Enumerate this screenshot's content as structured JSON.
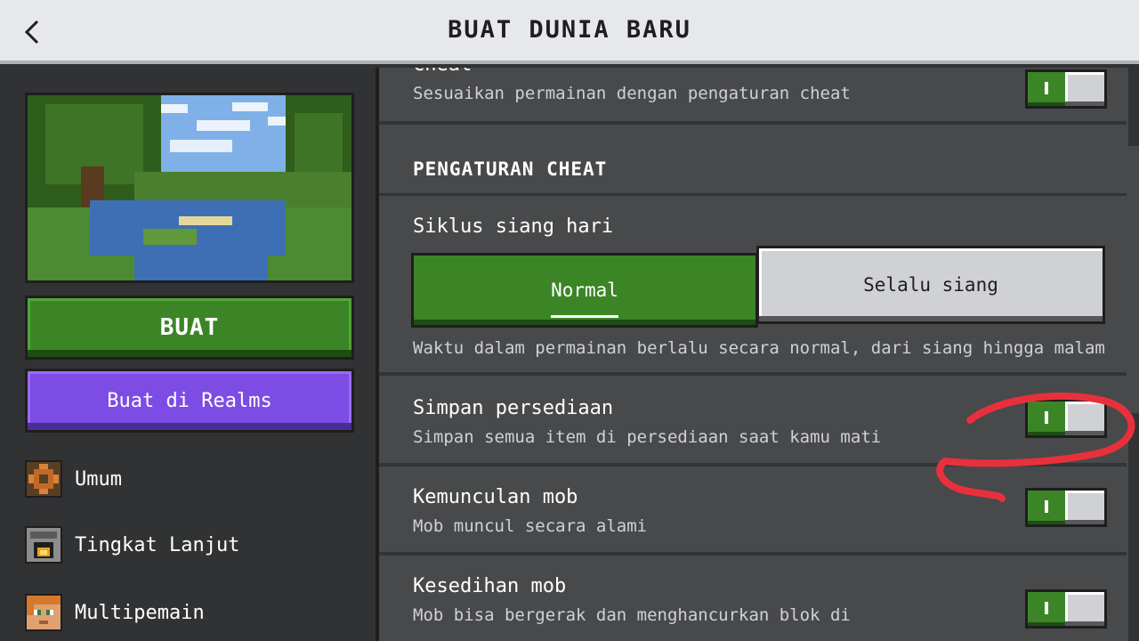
{
  "header": {
    "title": "BUAT DUNIA BARU",
    "back_icon": "chevron-left-icon"
  },
  "left": {
    "create_button": "BUAT",
    "realms_button": "Buat di Realms",
    "nav": [
      {
        "label": "Umum",
        "icon": "gear-icon"
      },
      {
        "label": "Tingkat Lanjut",
        "icon": "furnace-icon"
      },
      {
        "label": "Multipemain",
        "icon": "player-face-icon"
      }
    ]
  },
  "right": {
    "cheat_row": {
      "title": "Cheat",
      "desc": "Sesuaikan permainan dengan pengaturan cheat",
      "toggle": true
    },
    "section_header": "PENGATURAN CHEAT",
    "day_cycle": {
      "title": "Siklus siang hari",
      "options": [
        "Normal",
        "Selalu siang"
      ],
      "selected": "Normal",
      "desc": "Waktu dalam permainan berlalu secara normal, dari siang hingga malam"
    },
    "settings": [
      {
        "title": "Simpan persediaan",
        "desc": "Simpan semua item di persediaan saat kamu mati",
        "toggle": true
      },
      {
        "title": "Kemunculan mob",
        "desc": "Mob muncul secara alami",
        "toggle": true
      },
      {
        "title": "Kesedihan mob",
        "desc": "Mob bisa bergerak dan menghancurkan blok di",
        "toggle": true
      }
    ]
  },
  "colors": {
    "accent_green": "#3c8527",
    "realms_purple": "#7d4ce4",
    "annotation_red": "#e8303c"
  }
}
